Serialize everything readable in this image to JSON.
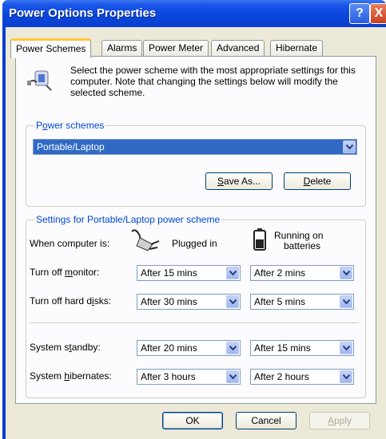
{
  "window": {
    "title": "Power Options Properties",
    "help_glyph": "?",
    "close_glyph": "X"
  },
  "tabs": [
    {
      "label": "Power Schemes",
      "active": true
    },
    {
      "label": "Alarms",
      "active": false
    },
    {
      "label": "Power Meter",
      "active": false
    },
    {
      "label": "Advanced",
      "active": false
    },
    {
      "label": "Hibernate",
      "active": false
    }
  ],
  "intro": {
    "text": "Select the power scheme with the most appropriate settings for this computer. Note that changing the settings below will modify the selected scheme."
  },
  "power_schemes": {
    "legend_pre": "P",
    "legend_u": "o",
    "legend_post": "wer schemes",
    "selected": "Portable/Laptop",
    "save_as_pre": "",
    "save_as_u": "S",
    "save_as_post": "ave As...",
    "delete_pre": "",
    "delete_u": "D",
    "delete_post": "elete"
  },
  "settings": {
    "legend": "Settings for Portable/Laptop power scheme",
    "when_label": "When computer is:",
    "plugged_in": "Plugged in",
    "running_on_batteries_1": "Running on",
    "running_on_batteries_2": "batteries",
    "monitor_label_pre": "Turn off ",
    "monitor_label_u": "m",
    "monitor_label_post": "onitor:",
    "monitor_plugged": "After 15 mins",
    "monitor_battery": "After 2 mins",
    "disks_label_pre": "Turn off hard d",
    "disks_label_u": "i",
    "disks_label_post": "sks:",
    "disks_plugged": "After 30 mins",
    "disks_battery": "After 5 mins",
    "standby_label_pre": "System s",
    "standby_label_u": "t",
    "standby_label_post": "andby:",
    "standby_plugged": "After 20 mins",
    "standby_battery": "After 15 mins",
    "hibernate_label_pre": "System ",
    "hibernate_label_u": "h",
    "hibernate_label_post": "ibernates:",
    "hibernate_plugged": "After 3 hours",
    "hibernate_battery": "After 2 hours"
  },
  "buttons": {
    "ok": "OK",
    "cancel": "Cancel",
    "apply_pre": "",
    "apply_u": "A",
    "apply_post": "pply"
  },
  "colors": {
    "titlebar": "#0a3fd0",
    "dialog_bg": "#ece9d8",
    "panel_bg": "#fcfcfe",
    "group_label": "#0046d5",
    "selection": "#316ac5"
  }
}
